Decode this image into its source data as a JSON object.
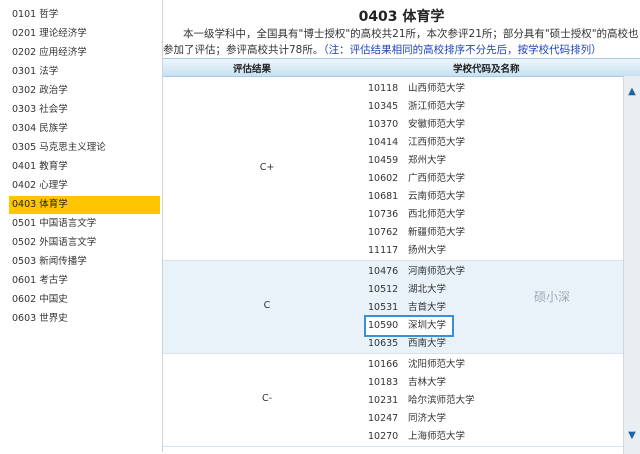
{
  "sidebar": {
    "items": [
      {
        "label": "0101 哲学"
      },
      {
        "label": "0201 理论经济学"
      },
      {
        "label": "0202 应用经济学"
      },
      {
        "label": "0301 法学"
      },
      {
        "label": "0302 政治学"
      },
      {
        "label": "0303 社会学"
      },
      {
        "label": "0304 民族学"
      },
      {
        "label": "0305 马克思主义理论"
      },
      {
        "label": "0401 教育学"
      },
      {
        "label": "0402 心理学"
      },
      {
        "label": "0403 体育学"
      },
      {
        "label": "0501 中国语言文学"
      },
      {
        "label": "0502 外国语言文学"
      },
      {
        "label": "0503 新闻传播学"
      },
      {
        "label": "0601 考古学"
      },
      {
        "label": "0602 中国史"
      },
      {
        "label": "0603 世界史"
      }
    ],
    "active_index": 10
  },
  "main": {
    "title": "0403 体育学",
    "desc_line1": "本一级学科中，全国具有\"博士授权\"的高校共21所，本次参评21所；部分具有\"硕士授权\"的高校也",
    "desc_line2": "参加了评估；参评高校共计78所。",
    "desc_note": "（注：评估结果相同的高校排序不分先后，按学校代码排列）",
    "col_grade": "评估结果",
    "col_school": "学校代码及名称",
    "watermark": "硕小深"
  },
  "groups": [
    {
      "grade": "C+",
      "rows": [
        {
          "code": "10118",
          "name": "山西师范大学"
        },
        {
          "code": "10345",
          "name": "浙江师范大学"
        },
        {
          "code": "10370",
          "name": "安徽师范大学"
        },
        {
          "code": "10414",
          "name": "江西师范大学"
        },
        {
          "code": "10459",
          "name": "郑州大学"
        },
        {
          "code": "10602",
          "name": "广西师范大学"
        },
        {
          "code": "10681",
          "name": "云南师范大学"
        },
        {
          "code": "10736",
          "name": "西北师范大学"
        },
        {
          "code": "10762",
          "name": "新疆师范大学"
        },
        {
          "code": "11117",
          "name": "扬州大学"
        }
      ]
    },
    {
      "grade": "C",
      "rows": [
        {
          "code": "10476",
          "name": "河南师范大学"
        },
        {
          "code": "10512",
          "name": "湖北大学"
        },
        {
          "code": "10531",
          "name": "吉首大学"
        },
        {
          "code": "10590",
          "name": "深圳大学"
        },
        {
          "code": "10635",
          "name": "西南大学"
        }
      ]
    },
    {
      "grade": "C-",
      "rows": [
        {
          "code": "10166",
          "name": "沈阳师范大学"
        },
        {
          "code": "10183",
          "name": "吉林大学"
        },
        {
          "code": "10231",
          "name": "哈尔滨师范大学"
        },
        {
          "code": "10247",
          "name": "同济大学"
        },
        {
          "code": "10270",
          "name": "上海师范大学"
        }
      ]
    }
  ],
  "highlight_code": "10590",
  "icons": {
    "scroll_up": "chevron-up-icon",
    "scroll_down": "chevron-down-icon"
  }
}
